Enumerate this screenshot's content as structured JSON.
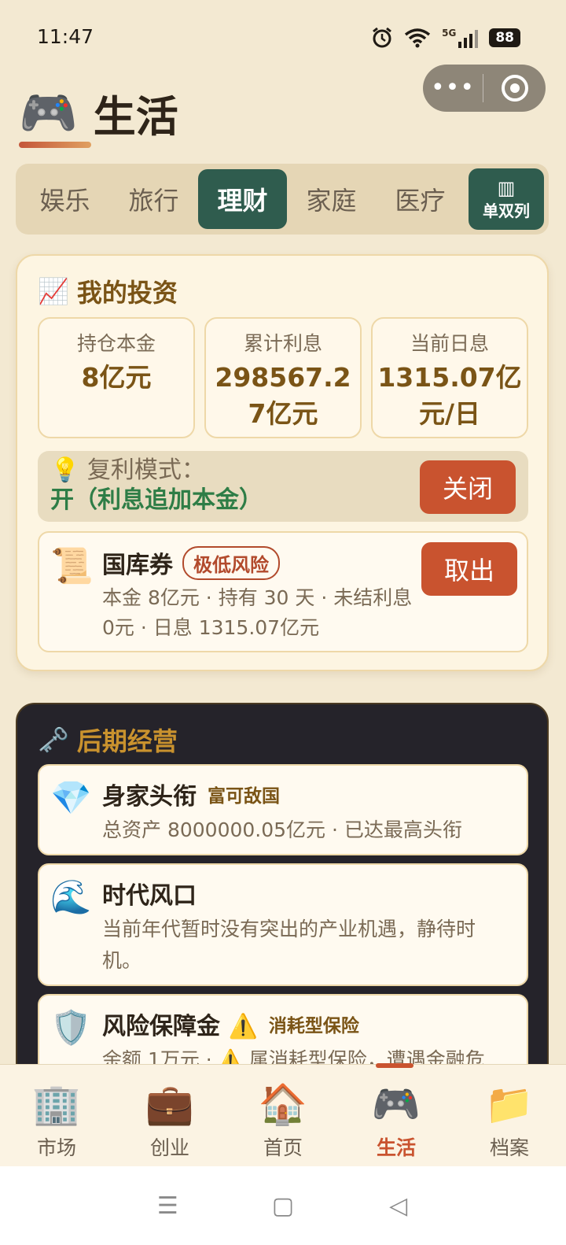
{
  "status_bar": {
    "time": "11:47",
    "signal": "5G",
    "battery": "88"
  },
  "capsule": {
    "menu_icon": "more-dots-icon",
    "close_icon": "target-icon"
  },
  "header": {
    "icon": "🎮",
    "title": "生活"
  },
  "tabs": [
    {
      "label": "娱乐",
      "active": false
    },
    {
      "label": "旅行",
      "active": false
    },
    {
      "label": "理财",
      "active": true
    },
    {
      "label": "家庭",
      "active": false
    },
    {
      "label": "医疗",
      "active": false
    }
  ],
  "layout_toggle": {
    "icon": "▥",
    "label": "单双列"
  },
  "investment": {
    "icon": "📈",
    "title": "我的投资",
    "stats": [
      {
        "label": "持仓本金",
        "value": "8亿元"
      },
      {
        "label": "累计利息",
        "value": "298567.27亿元"
      },
      {
        "label": "当前日息",
        "value": "1315.07亿元/日"
      }
    ],
    "compound": {
      "icon": "💡",
      "label": "复利模式：",
      "value": "开（利息追加本金）",
      "button": "关闭"
    },
    "bond": {
      "icon": "📜",
      "name": "国库券",
      "risk": "极低风险",
      "detail": "本金 8亿元 · 持有 30 天 · 未结利息 0元 · 日息 1315.07亿元",
      "button": "取出"
    }
  },
  "late_game": {
    "icon": "🗝️",
    "title": "后期经营",
    "items": [
      {
        "icon": "💎",
        "title": "身家头衔",
        "tag": "富可敌国",
        "desc": "总资产 8000000.05亿元 · 已达最高头衔"
      },
      {
        "icon": "🌊",
        "title": "时代风口",
        "tag": "",
        "desc": "当前年代暂时没有突出的产业机遇，静待时机。"
      },
      {
        "icon": "🛡️",
        "title": "风险保障金 ⚠️",
        "tag": "消耗型保险",
        "desc": "余额 1万元 · ⚠️ 属消耗型保险，遭遇金融危"
      }
    ]
  },
  "bottom_nav": [
    {
      "icon": "🏢",
      "label": "市场",
      "active": false
    },
    {
      "icon": "💼",
      "label": "创业",
      "active": false
    },
    {
      "icon": "🏠",
      "label": "首页",
      "active": false
    },
    {
      "icon": "🎮",
      "label": "生活",
      "active": true
    },
    {
      "icon": "📁",
      "label": "档案",
      "active": false
    }
  ],
  "system_nav": {
    "menu": "☰",
    "home": "▢",
    "back": "◁"
  }
}
